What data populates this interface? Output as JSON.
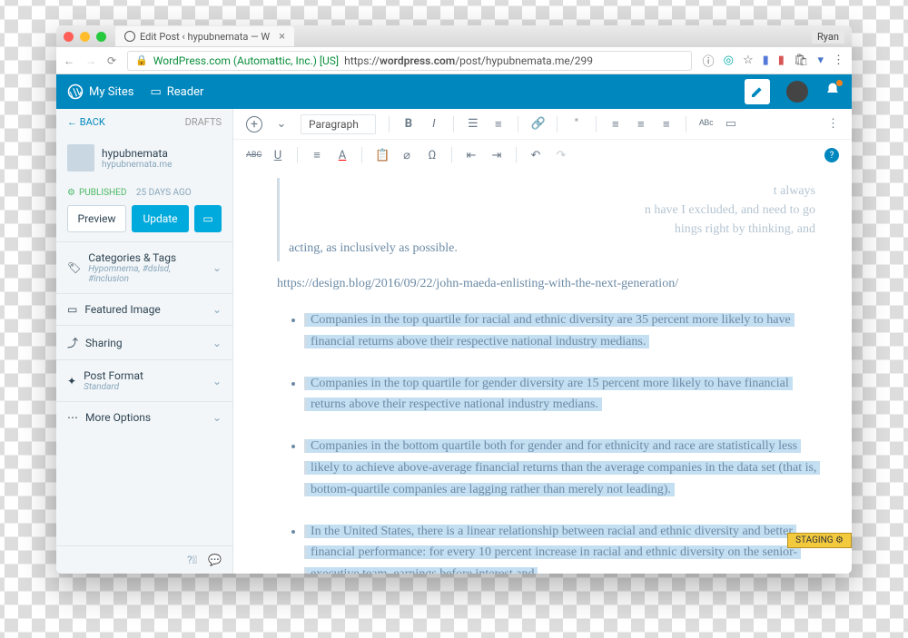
{
  "browser": {
    "tab_title": "Edit Post ‹ hypubnemata — W",
    "user": "Ryan",
    "company": "WordPress.com (Automattic, Inc.) [US]",
    "url_prefix": "https://",
    "url_host": "wordpress.com",
    "url_path": "/post/hypubnemata.me/299"
  },
  "topbar": {
    "my_sites": "My Sites",
    "reader": "Reader"
  },
  "sidebar": {
    "back": "BACK",
    "drafts": "DRAFTS",
    "site_name": "hypubnemata",
    "site_url": "hypubnemata.me",
    "published": "PUBLISHED",
    "published_ago": "25 DAYS AGO",
    "preview": "Preview",
    "update": "Update",
    "panels": {
      "categories": "Categories & Tags",
      "categories_sub": "Hypomnema, #dslsd, #inclusion",
      "featured": "Featured Image",
      "sharing": "Sharing",
      "post_format": "Post Format",
      "post_format_sub": "Standard",
      "more": "More Options"
    }
  },
  "toolbar": {
    "paragraph": "Paragraph",
    "abc": "ABC"
  },
  "content": {
    "quote_line1_tail": "t always",
    "quote_line2_tail": "n have I excluded, and need to go",
    "quote_line3_tail": "hings right by thinking, and",
    "quote_line4": "acting, as inclusively as possible.",
    "link": "https://design.blog/2016/09/22/john-maeda-enlisting-with-the-next-generation/",
    "bullets": [
      "Companies in the top quartile for racial and ethnic diversity are 35 percent more likely to have financial returns above their respective national industry medians.",
      "Companies in the top quartile for gender diversity are 15 percent more likely to have financial returns above their respective national industry medians.",
      "Companies in the bottom quartile both for gender and for ethnicity and race are statistically less likely to achieve above-average financial returns than the average companies in the data set (that is, bottom-quartile companies are lagging rather than merely not leading).",
      "In the United States, there is a linear relationship between racial and ethnic diversity and better financial performance: for every 10 percent increase in racial and ethnic diversity on the senior-executive team, earnings before interest and"
    ]
  },
  "staging": "STAGING"
}
